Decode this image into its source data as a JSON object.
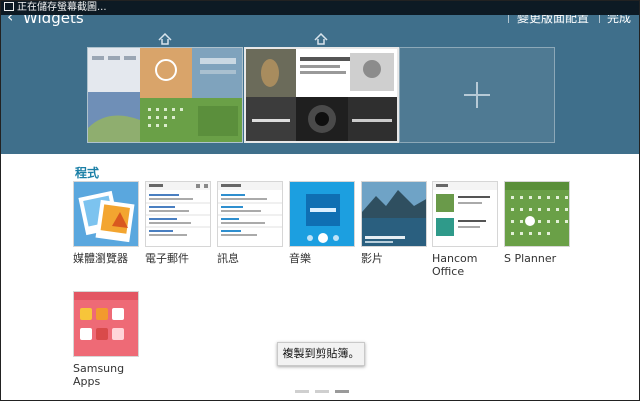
{
  "status_bar": {
    "notification": "正在儲存螢幕截圖..."
  },
  "header": {
    "title": "Widgets",
    "change_layout": "變更版面配置",
    "done": "完成"
  },
  "section": {
    "label": "程式"
  },
  "widgets": [
    {
      "label": "媒體瀏覽器",
      "icon": "gallery-widget-icon"
    },
    {
      "label": "電子郵件",
      "icon": "email-widget-icon"
    },
    {
      "label": "訊息",
      "icon": "messages-widget-icon"
    },
    {
      "label": "音樂",
      "icon": "music-widget-icon"
    },
    {
      "label": "影片",
      "icon": "video-widget-icon"
    },
    {
      "label": "Hancom Office",
      "icon": "hancom-office-widget-icon"
    },
    {
      "label": "S Planner",
      "icon": "s-planner-widget-icon"
    },
    {
      "label": "Samsung Apps",
      "icon": "samsung-apps-widget-icon"
    }
  ],
  "toast": {
    "text": "複製到剪貼簿。"
  },
  "pager": {
    "current_page": 3,
    "total_pages": 3
  },
  "colors": {
    "header_bg": "#3f6f8b",
    "section_label": "#1a7fa6"
  }
}
